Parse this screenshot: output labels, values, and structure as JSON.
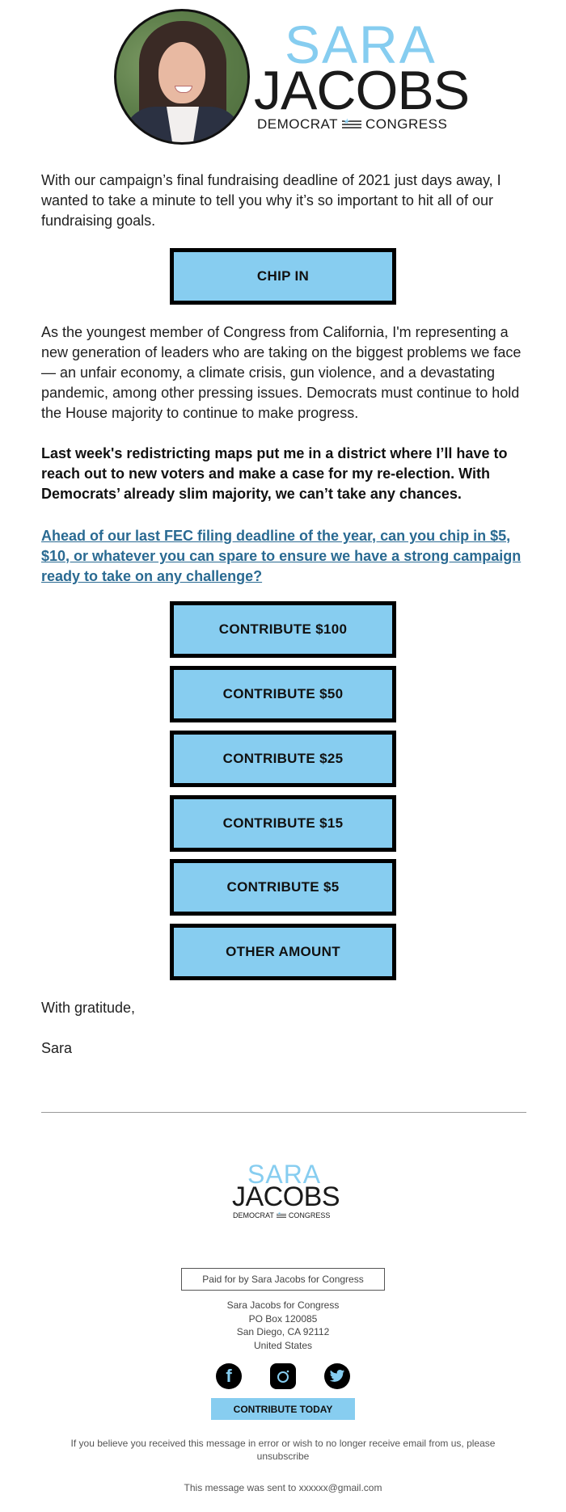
{
  "header": {
    "photo_alt": "Sara Jacobs portrait",
    "logo": {
      "first": "SARA",
      "last": "JACOBS",
      "tag_left": "DEMOCRAT",
      "tag_right": "CONGRESS"
    }
  },
  "body": {
    "intro": "With our campaign’s final fundraising deadline of 2021 just days away, I wanted to take a minute to tell you why it’s so important to hit all of our fundraising goals.",
    "chip_in_label": "CHIP IN",
    "paragraph2": "As the youngest member of Congress from California, I'm representing a new generation of leaders who are taking on the biggest problems we face — an unfair economy, a climate crisis, gun violence, and a devastating pandemic, among other pressing issues. Democrats must continue to hold the House majority to continue to make progress.",
    "bold_paragraph": "Last week's redistricting maps put me in a district where I’ll have to reach out to new voters and make a case for my re-election. With Democrats’ already slim majority, we can’t take any chances.",
    "link_paragraph": "Ahead of our last FEC filing deadline of the year, can you chip in $5, $10, or whatever you can spare to ensure we have a strong campaign ready to take on any challenge?",
    "contribute_buttons": [
      {
        "label": "CONTRIBUTE $100"
      },
      {
        "label": "CONTRIBUTE $50"
      },
      {
        "label": "CONTRIBUTE $25"
      },
      {
        "label": "CONTRIBUTE $15"
      },
      {
        "label": "CONTRIBUTE $5"
      },
      {
        "label": "OTHER AMOUNT"
      }
    ],
    "closing": "With gratitude,",
    "signature": "Sara"
  },
  "footer": {
    "logo": {
      "first": "SARA",
      "last": "JACOBS",
      "tag_left": "DEMOCRAT",
      "tag_right": "CONGRESS"
    },
    "paid_for": "Paid for by Sara Jacobs for Congress",
    "address": [
      "Sara Jacobs for Congress",
      "PO Box 120085",
      "San Diego, CA 92112",
      "United States"
    ],
    "social": [
      {
        "name": "facebook",
        "glyph": "f"
      },
      {
        "name": "instagram",
        "glyph": ""
      },
      {
        "name": "twitter",
        "glyph": ""
      }
    ],
    "contribute_today": "CONTRIBUTE TODAY",
    "unsubscribe_text": "If you believe you received this message in error or wish to no longer receive email from us, please",
    "unsubscribe_link": "unsubscribe",
    "sent_to": "This message was sent to xxxxxx@gmail.com"
  },
  "colors": {
    "accent": "#87cdf0",
    "link": "#2a6a92",
    "text": "#1f1f1f"
  }
}
